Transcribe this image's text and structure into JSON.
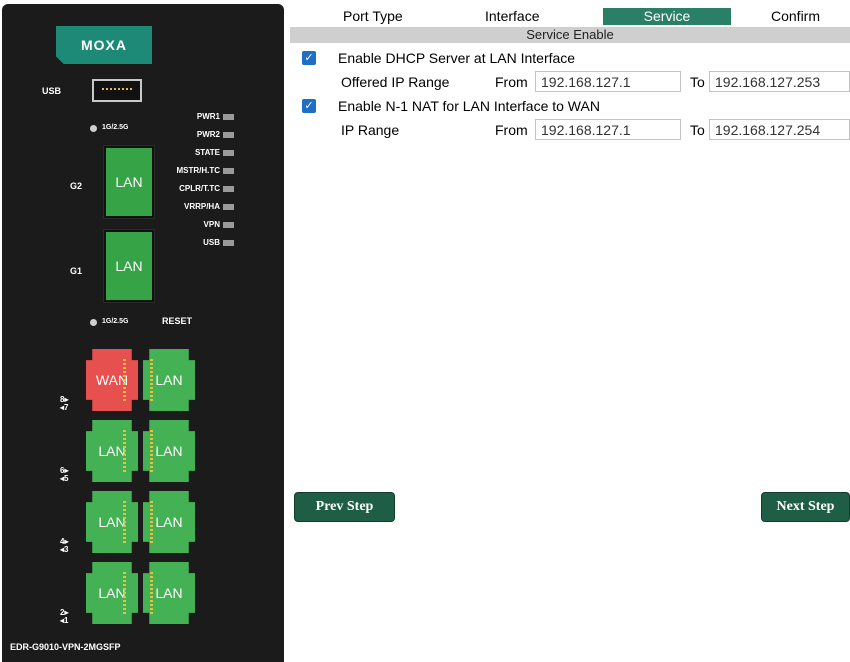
{
  "device": {
    "brand": "MOXA",
    "model": "EDR-G9010-VPN-2MGSFP",
    "usb_label": "USB",
    "leds": [
      "PWR1",
      "PWR2",
      "STATE",
      "MSTR/H.TC",
      "CPLR/T.TC",
      "VRRP/HA",
      "VPN",
      "USB"
    ],
    "speed_label_top": "1G/2.5G",
    "speed_label_bottom": "1G/2.5G",
    "reset_label": "RESET",
    "sfp_ports": [
      {
        "name": "G2",
        "label": "LAN"
      },
      {
        "name": "G1",
        "label": "LAN"
      }
    ],
    "rj45_ports": [
      {
        "label": "WAN"
      },
      {
        "label": "LAN"
      },
      {
        "label": "LAN"
      },
      {
        "label": "LAN"
      },
      {
        "label": "LAN"
      },
      {
        "label": "LAN"
      },
      {
        "label": "LAN"
      },
      {
        "label": "LAN"
      }
    ],
    "port_numbers": [
      {
        "top": "8▸",
        "bottom": "◂7"
      },
      {
        "top": "6▸",
        "bottom": "◂5"
      },
      {
        "top": "4▸",
        "bottom": "◂3"
      },
      {
        "top": "2▸",
        "bottom": "◂1"
      }
    ],
    "colors": {
      "panel": "#1b1b1b",
      "lan": "#43b154",
      "wan": "#e6504f",
      "brand": "#1d8a78"
    }
  },
  "wizard": {
    "steps": [
      "Port Type",
      "Interface",
      "Service",
      "Confirm"
    ],
    "active_step": "Service",
    "section_title": "Service Enable",
    "dhcp": {
      "checked": true,
      "label": "Enable DHCP Server at LAN Interface",
      "range_label": "Offered IP Range",
      "from_label": "From",
      "from_value": "192.168.127.1",
      "to_label": "To",
      "to_value": "192.168.127.253"
    },
    "nat": {
      "checked": true,
      "label": "Enable N-1 NAT for LAN Interface to WAN",
      "range_label": "IP Range",
      "from_label": "From",
      "from_value": "192.168.127.1",
      "to_label": "To",
      "to_value": "192.168.127.254"
    },
    "prev_button": "Prev Step",
    "next_button": "Next Step",
    "accent": "#2a8067"
  }
}
